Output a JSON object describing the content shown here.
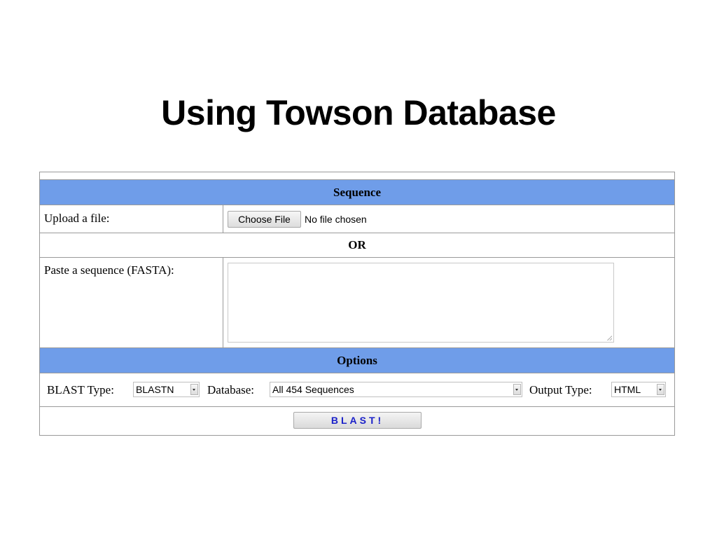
{
  "slide": {
    "title": "Using Towson Database"
  },
  "form": {
    "sequence_header": "Sequence",
    "upload_label": "Upload a file:",
    "choose_file_button": "Choose File",
    "file_status": "No file chosen",
    "or_label": "OR",
    "paste_label": "Paste a sequence (FASTA):",
    "sequence_value": "",
    "options_header": "Options",
    "blast_type_label": "BLAST Type:",
    "blast_type_value": "BLASTN",
    "database_label": "Database:",
    "database_value": "All 454 Sequences",
    "output_type_label": "Output Type:",
    "output_type_value": "HTML",
    "submit_button": "BLAST!"
  },
  "colors": {
    "header_bar": "#6f9de9",
    "submit_text": "#1a20c9",
    "border": "#9a9a9a"
  },
  "icons": {
    "select_arrow": "chevron-down-icon",
    "textarea_grip": "resize-grip-icon"
  }
}
